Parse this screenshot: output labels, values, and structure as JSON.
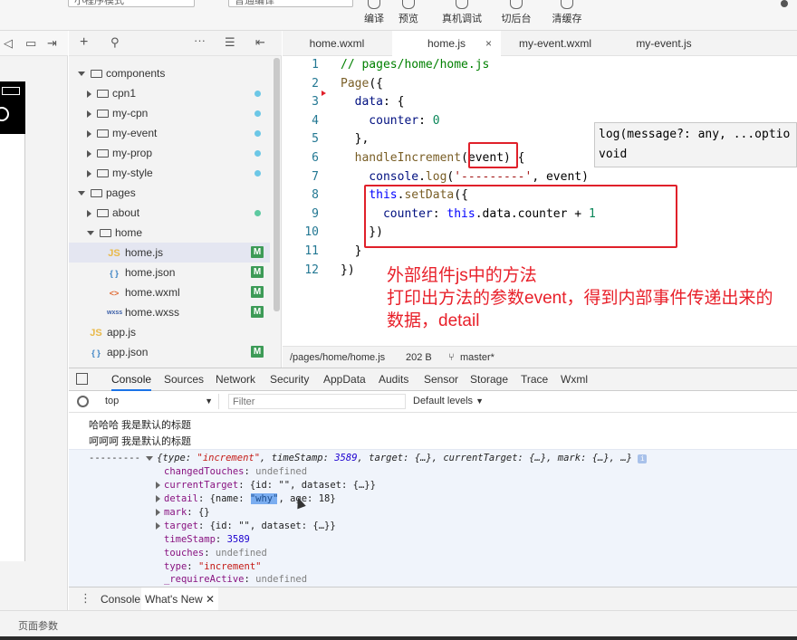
{
  "toolbar": {
    "mode_select": "小程序模式",
    "compile_select": "普通编译",
    "buttons": [
      {
        "label": "编译",
        "icon": "refresh-icon"
      },
      {
        "label": "预览",
        "icon": "eye-icon"
      },
      {
        "label": "真机调试",
        "icon": "bug-icon"
      },
      {
        "label": "切后台",
        "icon": "switch-icon"
      },
      {
        "label": "清缓存",
        "icon": "layers-icon"
      }
    ]
  },
  "tree": {
    "items": [
      {
        "label": "components"
      },
      {
        "label": "cpn1"
      },
      {
        "label": "my-cpn"
      },
      {
        "label": "my-event"
      },
      {
        "label": "my-prop"
      },
      {
        "label": "my-style"
      },
      {
        "label": "pages"
      },
      {
        "label": "about"
      },
      {
        "label": "home"
      },
      {
        "label": "home.js",
        "icon": "JS",
        "badge": "M"
      },
      {
        "label": "home.json",
        "icon": "{ }",
        "badge": "M"
      },
      {
        "label": "home.wxml",
        "icon": "<>",
        "badge": "M"
      },
      {
        "label": "home.wxss",
        "icon": "wxss",
        "badge": "M"
      },
      {
        "label": "app.js",
        "icon": "JS"
      },
      {
        "label": "app.json",
        "icon": "{ }",
        "badge": "M"
      }
    ]
  },
  "editor": {
    "tabs": [
      "home.wxml",
      "home.js",
      "my-event.wxml",
      "my-event.js"
    ],
    "close_glyph": "×",
    "line_numbers": [
      "1",
      "2",
      "3",
      "4",
      "5",
      "6",
      "7",
      "8",
      "9",
      "10",
      "11",
      "12"
    ],
    "code": {
      "l1": "// pages/home/home.js",
      "l2a": "Page",
      "l2b": "({",
      "l3a": "  data",
      "l3b": ": {",
      "l4a": "    counter",
      "l4b": ": ",
      "l4c": "0",
      "l5": "  },",
      "l6a": "  handleIncrement",
      "l6b": "(event) {",
      "l7a": "    console",
      "l7b": ".",
      "l7c": "log",
      "l7d": "(",
      "l7e": "'---------'",
      "l7f": ", event)",
      "l8a": "    ",
      "l8b": "this",
      "l8c": ".",
      "l8d": "setData",
      "l8e": "({",
      "l9a": "      counter",
      "l9b": ": ",
      "l9c": "this",
      "l9d": ".data.counter + ",
      "l9e": "1",
      "l10": "    })",
      "l11": "  }",
      "l12": "})"
    },
    "tooltip_line1": "log(message?: any, ...optio",
    "tooltip_line2": "void",
    "status_path": "/pages/home/home.js",
    "status_size": "202 B",
    "status_branch": "master*"
  },
  "annotation": {
    "line1": "外部组件js中的方法",
    "line2": "打印出方法的参数event，得到内部事件传递出来的数据，detail"
  },
  "devtools": {
    "tabs": [
      "Console",
      "Sources",
      "Network",
      "Security",
      "AppData",
      "Audits",
      "Sensor",
      "Storage",
      "Trace",
      "Wxml"
    ],
    "context": "top",
    "filter_placeholder": "Filter",
    "levels": "Default levels",
    "logs": [
      "哈哈哈 我是默认的标题",
      "呵呵呵 我是默认的标题"
    ],
    "event_prefix": "---------",
    "event_summary_a": "{type: ",
    "event_summary_b": "\"increment\"",
    "event_summary_c": ", timeStamp: ",
    "event_summary_d": "3589",
    "event_summary_e": ", target: {…}, currentTarget: {…}, mark: {…}, …}",
    "props": [
      {
        "key": "changedTouches",
        "val": "undefined",
        "kind": "gray",
        "expandable": false
      },
      {
        "key": "currentTarget",
        "val": "{id: \"\", dataset: {…}}",
        "kind": "plain",
        "expandable": true
      },
      {
        "key": "detail",
        "val": "{name: \"why\", age: 18}",
        "kind": "plain",
        "expandable": true
      },
      {
        "key": "mark",
        "val": "{}",
        "kind": "plain",
        "expandable": true
      },
      {
        "key": "target",
        "val": "{id: \"\", dataset: {…}}",
        "kind": "plain",
        "expandable": true
      },
      {
        "key": "timeStamp",
        "val": "3589",
        "kind": "num",
        "expandable": false
      },
      {
        "key": "touches",
        "val": "undefined",
        "kind": "gray",
        "expandable": false
      },
      {
        "key": "type",
        "val": "\"increment\"",
        "kind": "str",
        "expandable": false
      },
      {
        "key": "_requireActive",
        "val": "undefined",
        "kind": "gray",
        "expandable": false
      }
    ],
    "drawer_tabs": [
      "Console",
      "What's New"
    ]
  },
  "bottom": {
    "page_params": "页面参数"
  }
}
